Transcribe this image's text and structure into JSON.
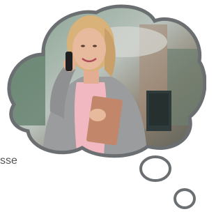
{
  "caption": {
    "visible_text": "sse"
  },
  "image": {
    "subject": "woman-on-phone-holding-folder",
    "frame_shape": "thought-bubble",
    "colors": {
      "bubble_outline": "#6b6f72",
      "background_bokeh": "#5f7c68",
      "jacket": "#9a9c9e",
      "top": "#f2b8c2",
      "folder": "#c2876a",
      "hair": "#d9b27a",
      "skin": "#e7b99d"
    }
  }
}
